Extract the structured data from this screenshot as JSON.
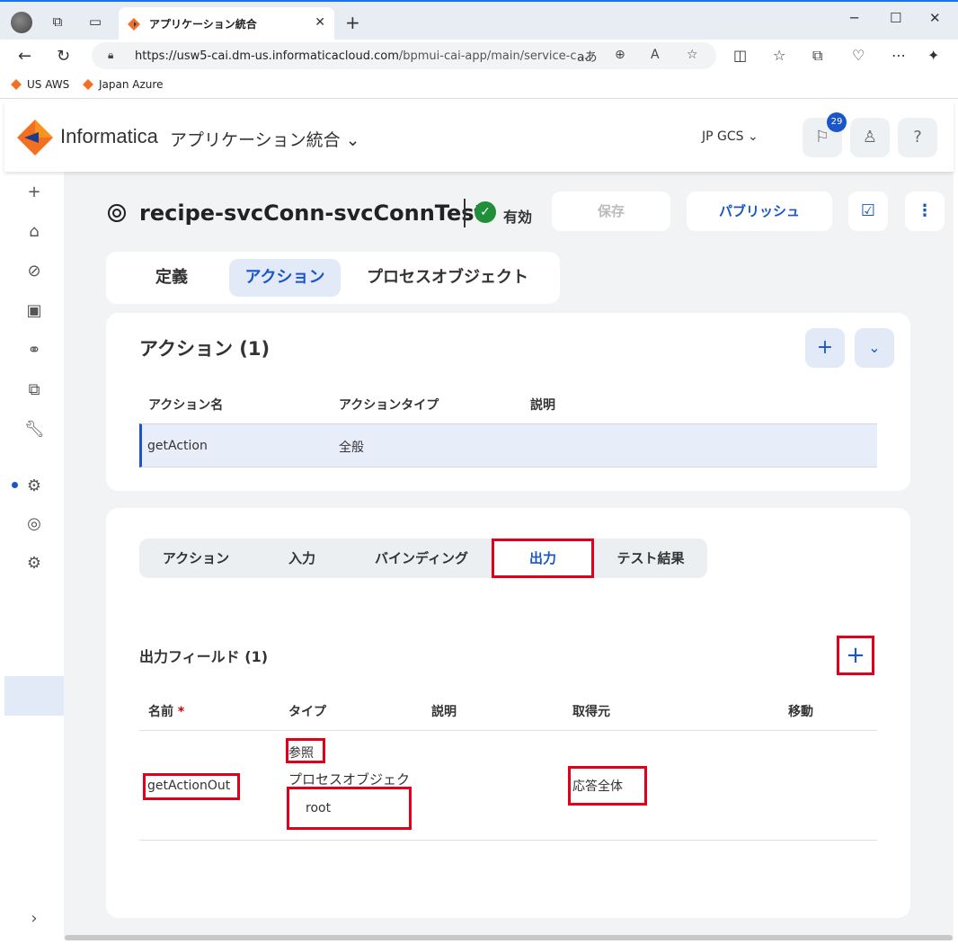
{
  "browser": {
    "tab_title": "アプリケーション統合",
    "url_domain": "https://usw5-cai.dm-us.informaticacloud.com",
    "url_path": "/bpmui-cai-app/main/service-c...",
    "bookmarks": [
      "US AWS",
      "Japan Azure"
    ]
  },
  "header": {
    "brand": "Informatica",
    "app_name": "アプリケーション統合",
    "region": "JP GCS",
    "notification_count": "29"
  },
  "page": {
    "title": "recipe-svcConn-svcConnTest",
    "status": "有効",
    "save_label": "保存",
    "publish_label": "パブリッシュ"
  },
  "main_tabs": [
    "定義",
    "アクション",
    "プロセスオブジェクト"
  ],
  "actions_card": {
    "title": "アクション (1)",
    "columns": [
      "アクション名",
      "アクションタイプ",
      "説明"
    ],
    "rows": [
      {
        "name": "getAction",
        "type": "全般",
        "desc": ""
      }
    ]
  },
  "sub_tabs": [
    "アクション",
    "入力",
    "バインディング",
    "出力",
    "テスト結果"
  ],
  "output": {
    "title": "出力フィールド (1)",
    "columns": [
      "名前",
      "タイプ",
      "説明",
      "取得元",
      "移動"
    ],
    "required_mark": "*",
    "row": {
      "name": "getActionOut",
      "type_ref": "参照",
      "type_kind": "プロセスオブジェク",
      "type_obj": "root",
      "source": "応答全体"
    }
  },
  "colors": {
    "accent": "#1a56c8",
    "highlight": "#e0001a",
    "status_ok": "#1f8f3a"
  }
}
